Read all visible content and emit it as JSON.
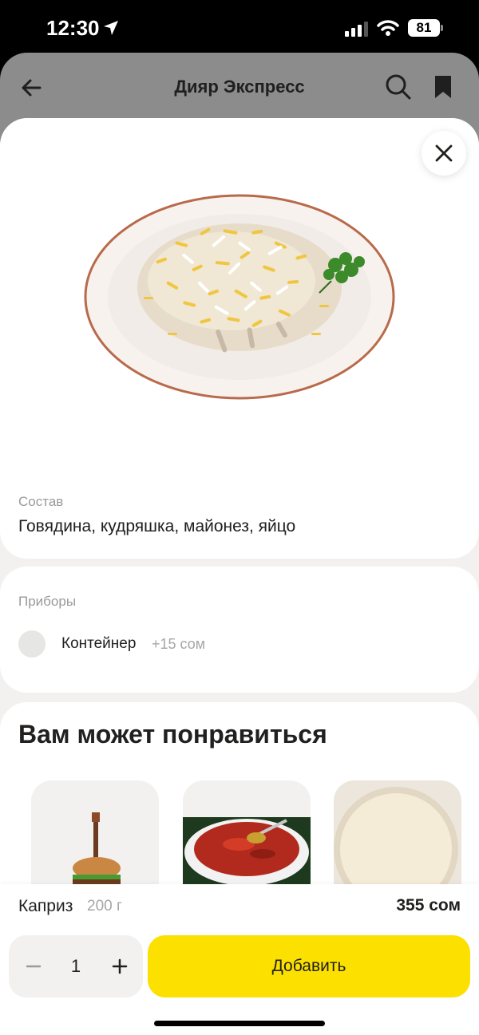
{
  "status_bar": {
    "time": "12:30",
    "battery": "81"
  },
  "header": {
    "title": "Дияр Экспресс"
  },
  "product": {
    "composition_label": "Состав",
    "composition": "Говядина, кудряшка, майонез, яйцо"
  },
  "utensils": {
    "label": "Приборы",
    "option_name": "Контейнер",
    "option_price": "+15 сом"
  },
  "recommendations": {
    "title": "Вам может понравиться"
  },
  "bottom": {
    "item_name": "Каприз",
    "item_weight": "200 г",
    "item_price": "355 сом",
    "quantity": "1",
    "add_label": "Добавить"
  },
  "colors": {
    "accent": "#fce000",
    "background": "#f2f1f0",
    "dim_header": "#8c8c8c"
  }
}
